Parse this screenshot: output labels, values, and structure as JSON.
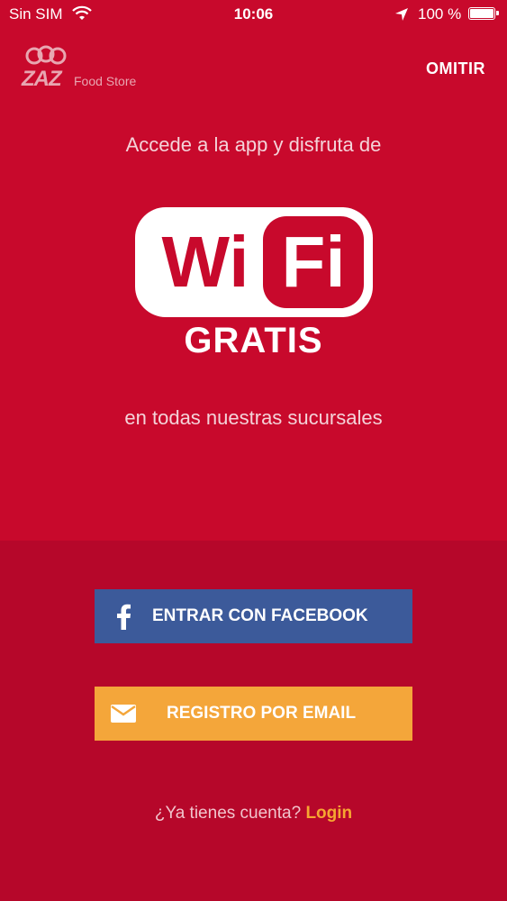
{
  "status_bar": {
    "carrier": "Sin SIM",
    "time": "10:06",
    "battery_pct": "100 %",
    "icons": [
      "wifi-icon",
      "location-arrow-icon",
      "battery-icon"
    ]
  },
  "header": {
    "logo_text": "ZAZ",
    "logo_sub": "Food Store",
    "skip_label": "OMITIR"
  },
  "promo": {
    "line1": "Accede a la app y disfruta de",
    "wifi_word_1": "Wi",
    "wifi_word_2": "Fi",
    "gratis": "GRATIS",
    "line2": "en todas nuestras sucursales"
  },
  "actions": {
    "facebook_label": "ENTRAR CON FACEBOOK",
    "email_label": "REGISTRO POR EMAIL"
  },
  "footer": {
    "question": "¿Ya tienes cuenta?",
    "login_label": "Login"
  },
  "colors": {
    "background_top": "#c8092c",
    "background_bottom": "#b6072a",
    "facebook": "#3c5a9a",
    "email": "#f4a63a",
    "login_link": "#f6a631"
  }
}
